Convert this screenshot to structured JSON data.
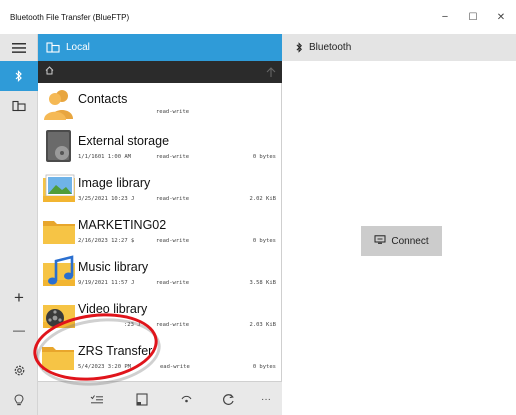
{
  "window": {
    "title": "Bluetooth File Transfer (BlueFTP)",
    "minimize_glyph": "−",
    "maximize_glyph": "☐",
    "close_glyph": "✕"
  },
  "rail": {
    "menu_icon": "hamburger-menu-icon",
    "bluetooth_icon": "bluetooth-icon",
    "local_icon": "local-drive-icon",
    "zoom_in_glyph": "+",
    "zoom_out_glyph": "—",
    "settings_icon": "gear-icon",
    "tips_icon": "lightbulb-icon"
  },
  "local_pane": {
    "header_label": "Local",
    "header_icon": "local-drive-icon",
    "path_home_icon": "home-icon",
    "up_icon": "arrow-up-icon"
  },
  "files": [
    {
      "name": "Contacts",
      "date": "",
      "permission": "read-write",
      "size": "",
      "icon": "contacts-icon"
    },
    {
      "name": "External storage",
      "date": "1/1/1601 1:00 AM",
      "permission": "read-write",
      "size": "0 bytes",
      "icon": "external-storage-icon"
    },
    {
      "name": "Image library",
      "date": "3/25/2021 10:23 J",
      "permission": "read-write",
      "size": "2.02 KiB",
      "icon": "image-library-icon"
    },
    {
      "name": "MARKETING02",
      "date": "2/16/2023 12:27 $",
      "permission": "read-write",
      "size": "0 bytes",
      "icon": "folder-icon"
    },
    {
      "name": "Music library",
      "date": "9/19/2021 11:57 J",
      "permission": "read-write",
      "size": "3.58 KiB",
      "icon": "music-library-icon"
    },
    {
      "name": "Video library",
      "date": ":23 J",
      "permission": "read-write",
      "size": "2.03 KiB",
      "icon": "video-library-icon"
    },
    {
      "name": "ZRS Transfer",
      "date": "5/4/2023 3:20 PM",
      "permission": "ead-write",
      "size": "0 bytes",
      "icon": "folder-icon"
    }
  ],
  "toolbar": {
    "select_icon": "select-list-icon",
    "window_icon": "new-window-icon",
    "bluetooth_signal_icon": "signal-icon",
    "refresh_icon": "refresh-icon",
    "more_glyph": "···"
  },
  "bluetooth_pane": {
    "header_label": "Bluetooth",
    "header_icon": "bluetooth-icon",
    "connect_label": "Connect",
    "connect_icon": "monitor-connect-icon"
  },
  "colors": {
    "accent": "#2f9bd8",
    "annotation": "#e0141b",
    "folder": "#f6c445"
  }
}
